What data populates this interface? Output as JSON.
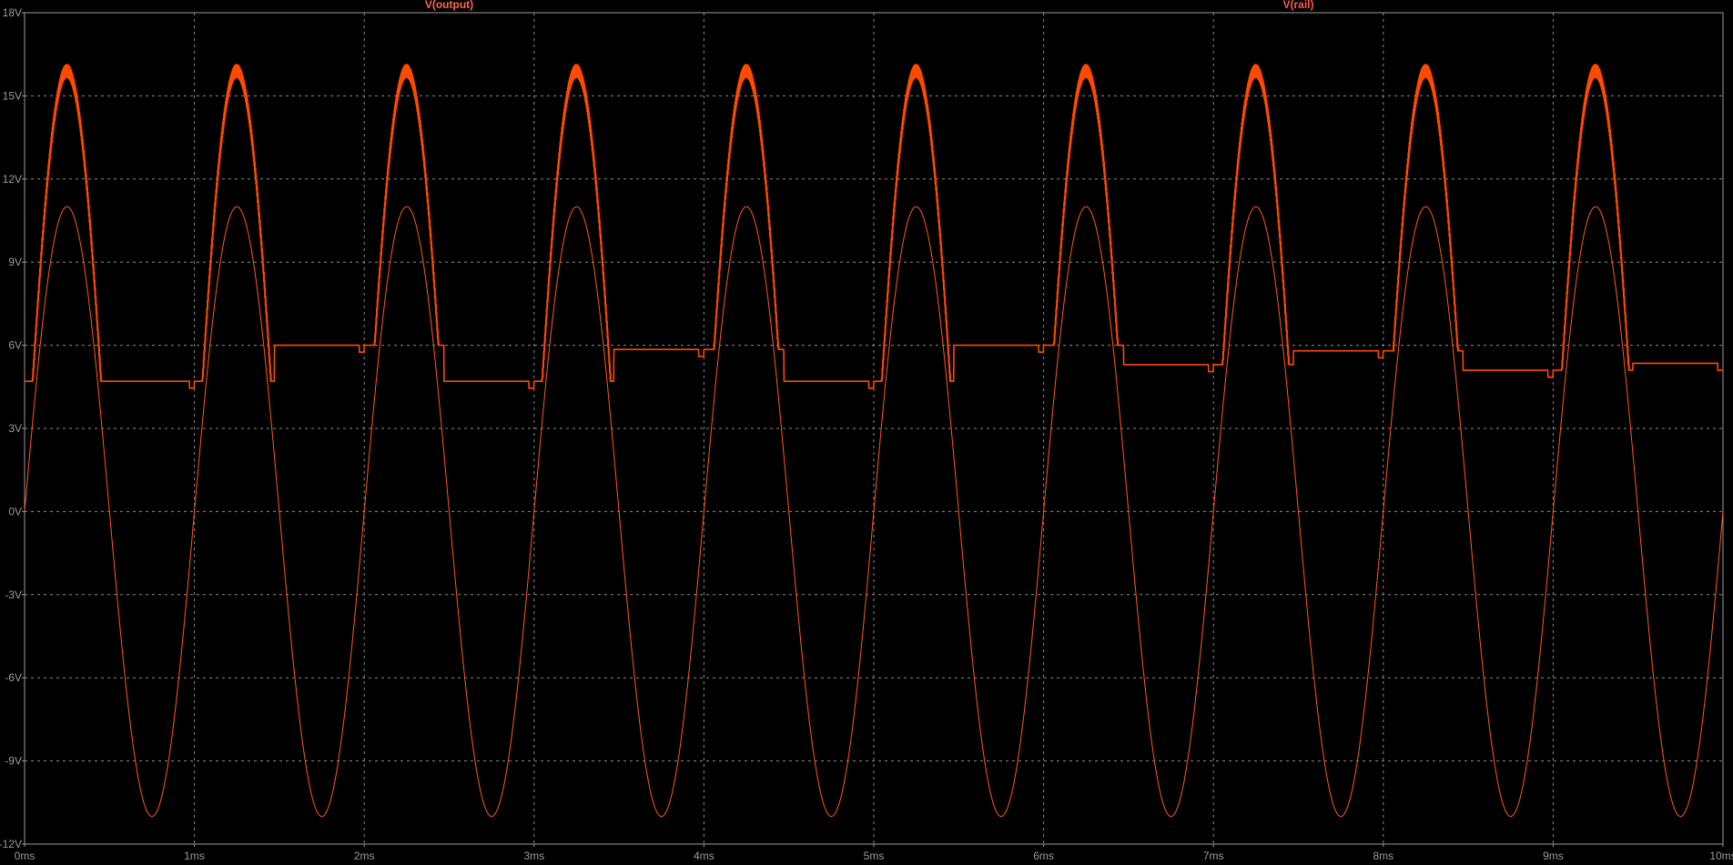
{
  "colors": {
    "background": "#000000",
    "frame": "#9a9a9a",
    "grid": "#8a8a8a",
    "axis_text": "#9a9a9a",
    "output_trace": "#ff5a1f",
    "rail_trace": "#ff4a00",
    "output_label": "#ff6a4a",
    "rail_label": "#ff5a3a"
  },
  "chart_data": {
    "type": "line",
    "title": "",
    "xlabel": "",
    "ylabel": "",
    "xlim": [
      0,
      10
    ],
    "ylim": [
      -12,
      18
    ],
    "x_unit": "ms",
    "y_unit": "V",
    "grid": true,
    "x_ticks": [
      0,
      1,
      2,
      3,
      4,
      5,
      6,
      7,
      8,
      9,
      10
    ],
    "x_tick_labels": [
      "0ms",
      "1ms",
      "2ms",
      "3ms",
      "4ms",
      "5ms",
      "6ms",
      "7ms",
      "8ms",
      "9ms",
      "10ms"
    ],
    "y_ticks": [
      18,
      15,
      12,
      9,
      6,
      3,
      0,
      -3,
      -6,
      -9,
      -12
    ],
    "y_tick_labels": [
      "18V",
      "15V",
      "12V",
      "9V",
      "6V",
      "3V",
      "0V",
      "-3V",
      "-6V",
      "-9V",
      "-12V"
    ],
    "series": [
      {
        "name": "V(output)",
        "kind": "sine",
        "amplitude": 11,
        "offset": 0,
        "period": 1,
        "color": "#ff5a1f"
      },
      {
        "name": "V(rail)",
        "kind": "rectified_pulse",
        "peak": 15.9,
        "pulse_width": 0.47,
        "ripple": 0.25,
        "floor_levels": [
          4.7,
          6.0,
          4.7,
          5.85,
          4.7,
          6.0,
          5.3,
          5.8,
          5.1,
          5.35
        ],
        "color": "#ff4a00"
      }
    ]
  }
}
